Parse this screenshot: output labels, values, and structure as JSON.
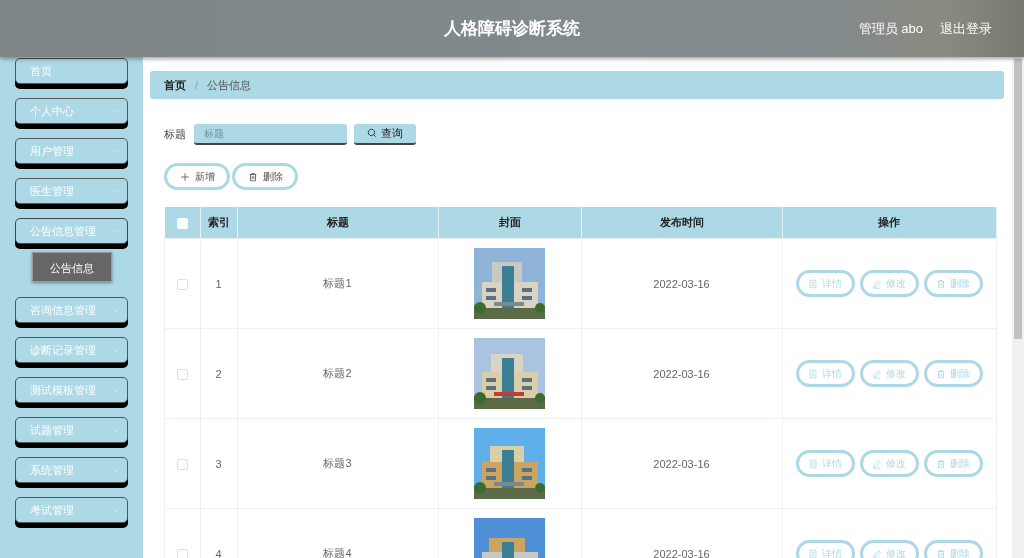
{
  "header": {
    "title": "人格障碍诊断系统",
    "user": "管理员 abo",
    "logout": "退出登录"
  },
  "sidebar": {
    "items": [
      {
        "label": "首页",
        "kind": "link"
      },
      {
        "label": "个人中心",
        "kind": "menu",
        "expanded": false
      },
      {
        "label": "用户管理",
        "kind": "menu",
        "expanded": false
      },
      {
        "label": "医生管理",
        "kind": "menu",
        "expanded": false
      },
      {
        "label": "公告信息管理",
        "kind": "menu",
        "expanded": true,
        "children": [
          {
            "label": "公告信息",
            "selected": true
          }
        ]
      },
      {
        "label": "咨询信息管理",
        "kind": "menu",
        "expanded": false
      },
      {
        "label": "诊断记录管理",
        "kind": "menu",
        "expanded": false
      },
      {
        "label": "测试模板管理",
        "kind": "menu",
        "expanded": false
      },
      {
        "label": "试题管理",
        "kind": "menu",
        "expanded": false
      },
      {
        "label": "系统管理",
        "kind": "menu",
        "expanded": false
      },
      {
        "label": "考试管理",
        "kind": "menu",
        "expanded": false
      }
    ]
  },
  "breadcrumb": {
    "items": [
      "首页",
      "公告信息"
    ],
    "separator": "/"
  },
  "search": {
    "label": "标题",
    "placeholder": "标题",
    "button": "查询"
  },
  "actions": [
    {
      "label": "新增",
      "kind": "add"
    },
    {
      "label": "删除",
      "kind": "delete"
    }
  ],
  "table": {
    "columns": [
      "索引",
      "标题",
      "封面",
      "发布时间",
      "操作"
    ],
    "select_all": {
      "checked": false
    },
    "rows": [
      {
        "selected": false,
        "index": "1",
        "title": "标题1",
        "cover": {
          "kind": "picture"
        },
        "date": "2022-03-16",
        "buttons": [
          {
            "label": "详情",
            "kind": "detail"
          },
          {
            "label": "修改",
            "kind": "edit"
          },
          {
            "label": "删除",
            "kind": "delete"
          }
        ]
      },
      {
        "selected": false,
        "index": "2",
        "title": "标题2",
        "cover": {
          "kind": "picture"
        },
        "date": "2022-03-16",
        "buttons": [
          {
            "label": "详情",
            "kind": "detail"
          },
          {
            "label": "修改",
            "kind": "edit"
          },
          {
            "label": "删除",
            "kind": "delete"
          }
        ]
      },
      {
        "selected": false,
        "index": "3",
        "title": "标题3",
        "cover": {
          "kind": "picture"
        },
        "date": "2022-03-16",
        "buttons": [
          {
            "label": "详情",
            "kind": "detail"
          },
          {
            "label": "修改",
            "kind": "edit"
          },
          {
            "label": "删除",
            "kind": "delete"
          }
        ]
      },
      {
        "selected": false,
        "index": "4",
        "title": "标题4",
        "cover": {
          "kind": "picture"
        },
        "date": "2022-03-16",
        "buttons": [
          {
            "label": "详情",
            "kind": "detail"
          },
          {
            "label": "修改",
            "kind": "edit"
          },
          {
            "label": "删除",
            "kind": "delete"
          }
        ]
      }
    ]
  }
}
